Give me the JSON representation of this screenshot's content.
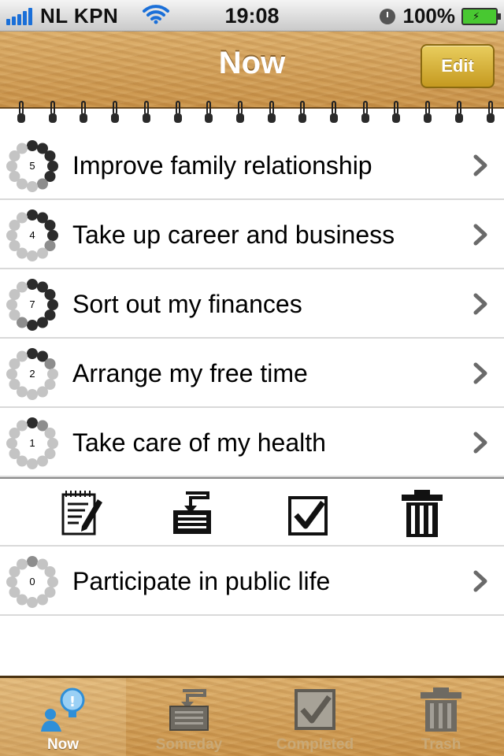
{
  "status_bar": {
    "carrier": "NL KPN",
    "time": "19:08",
    "battery": "100%"
  },
  "nav": {
    "title": "Now",
    "edit_label": "Edit"
  },
  "goals": [
    {
      "label": "Improve family relationship",
      "count": "5"
    },
    {
      "label": "Take up career and business",
      "count": "4"
    },
    {
      "label": "Sort out my finances",
      "count": "7"
    },
    {
      "label": "Arrange my free time",
      "count": "2"
    },
    {
      "label": "Take care of my health",
      "count": "1"
    }
  ],
  "toolbar": {
    "icons": [
      "notepad-pen-icon",
      "inbox-tray-icon",
      "checkbox-icon",
      "trash-icon"
    ]
  },
  "extra_goals": [
    {
      "label": "Participate in public life",
      "count": "0"
    }
  ],
  "tabs": [
    {
      "label": "Now",
      "icon": "person-bulb-icon",
      "selected": true
    },
    {
      "label": "Someday",
      "icon": "inbox-tray-icon",
      "selected": false
    },
    {
      "label": "Completed",
      "icon": "checkbox-icon",
      "selected": false
    },
    {
      "label": "Trash",
      "icon": "trash-icon",
      "selected": false
    }
  ],
  "colors": {
    "wood": "#d6a35c",
    "edit_button": "#d6b33e",
    "dot_dark": "#2b2b2b",
    "dot_light": "#c4c4c4"
  }
}
